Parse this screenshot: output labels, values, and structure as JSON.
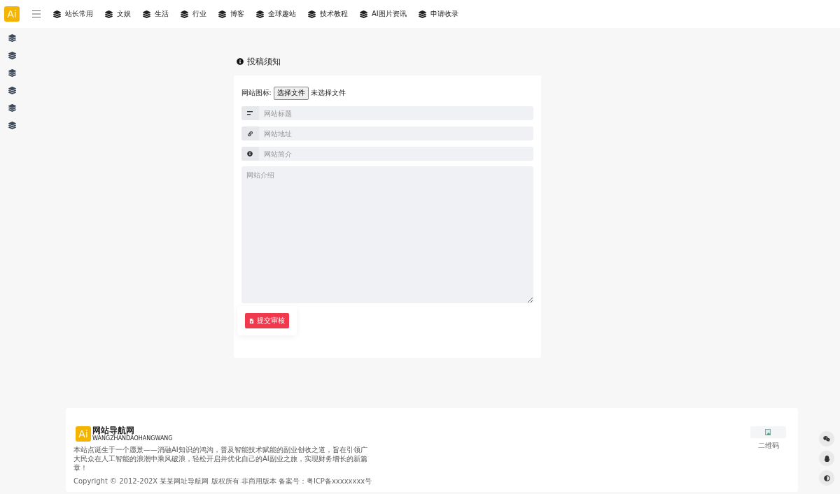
{
  "header": {
    "logo": "Ai",
    "nav": [
      {
        "label": "站长常用"
      },
      {
        "label": "文娱"
      },
      {
        "label": "生活"
      },
      {
        "label": "行业"
      },
      {
        "label": "博客"
      },
      {
        "label": "全球趣站"
      },
      {
        "label": "技术教程"
      },
      {
        "label": "AI图片资讯"
      },
      {
        "label": "申请收录"
      }
    ]
  },
  "form": {
    "title": "投稿须知",
    "icon_label": "网站图标:",
    "file_button": "选择文件",
    "file_status": "未选择文件",
    "fields": [
      {
        "kind": "title",
        "placeholder": "网站标题"
      },
      {
        "kind": "link",
        "placeholder": "网站地址"
      },
      {
        "kind": "info",
        "placeholder": "网站简介"
      }
    ],
    "textarea": {
      "placeholder": "网站介绍"
    },
    "submit": "提交审核"
  },
  "footer": {
    "logo_mark": "Ai",
    "logo_name": "网站导航网",
    "logo_sub": "WANGZHANDAOHANGWANG",
    "description": "本站点诞生于一个愿景——消融AI知识的鸿沟，普及智能技术赋能的副业创收之道，旨在引领广大民众在人工智能的浪潮中乘风破浪，轻松开启并优化自己的AI副业之旅，实现财务增长的新篇章！",
    "copyright": "Copyright © 2012-202X 某某网址导航网 版权所有 非商用版本 备案号：粤ICP备xxxxxxxx号",
    "qr_caption": "二维码"
  },
  "float_buttons": [
    {
      "kind": "wechat"
    },
    {
      "kind": "qq"
    },
    {
      "kind": "theme"
    }
  ]
}
